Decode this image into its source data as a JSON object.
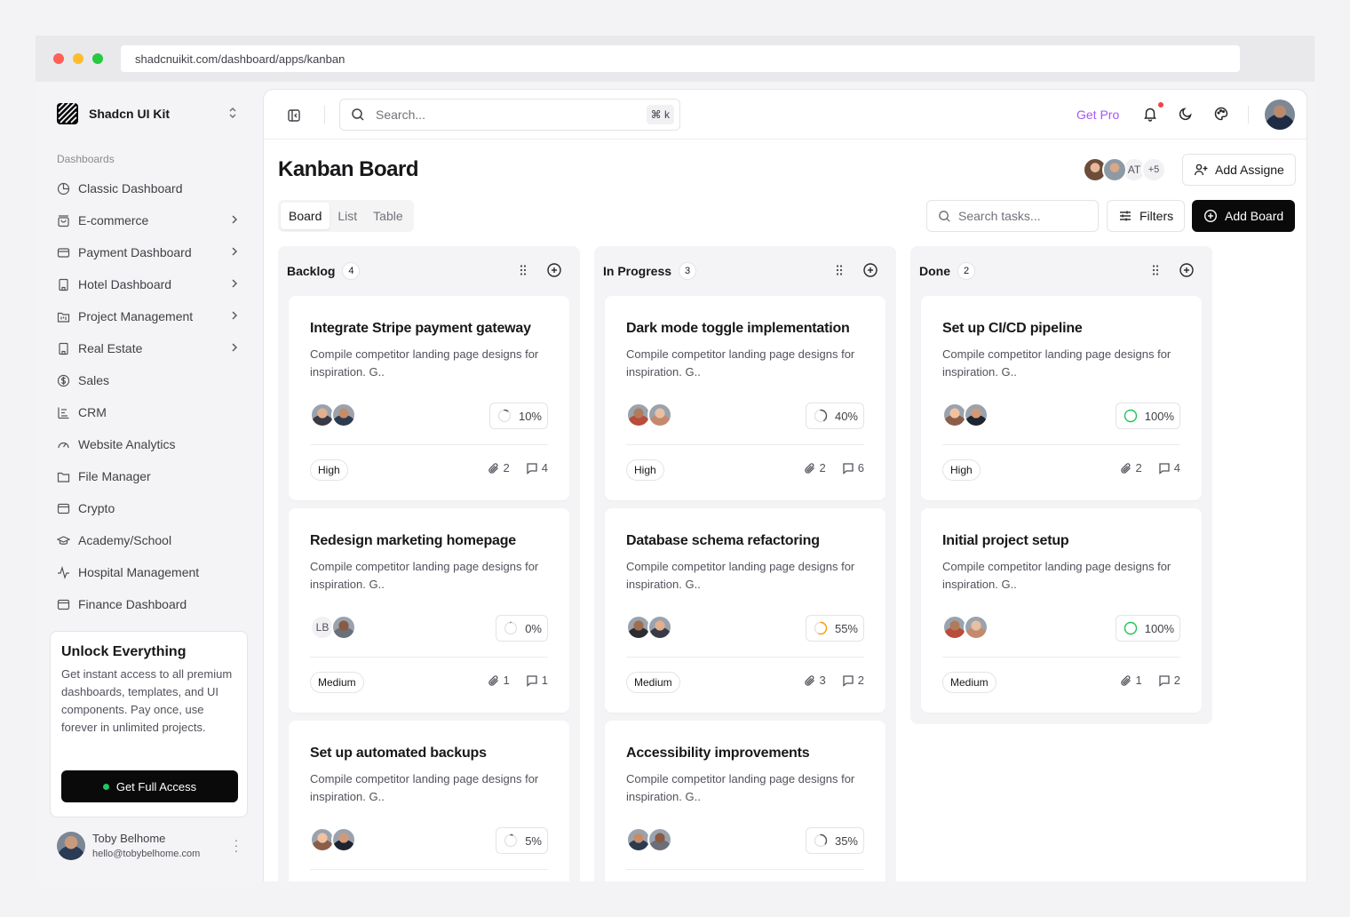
{
  "browser": {
    "url": "shadcnuikit.com/dashboard/apps/kanban"
  },
  "sidebar": {
    "brand": "Shadcn UI Kit",
    "section_label": "Dashboards",
    "items": [
      {
        "label": "Classic Dashboard",
        "icon": "pie-chart-icon",
        "chevron": false
      },
      {
        "label": "E-commerce",
        "icon": "shopping-bag-icon",
        "chevron": true
      },
      {
        "label": "Payment Dashboard",
        "icon": "credit-card-icon",
        "chevron": true
      },
      {
        "label": "Hotel Dashboard",
        "icon": "building-icon",
        "chevron": true
      },
      {
        "label": "Project Management",
        "icon": "folder-kanban-icon",
        "chevron": true
      },
      {
        "label": "Real Estate",
        "icon": "building-icon",
        "chevron": true
      },
      {
        "label": "Sales",
        "icon": "badge-dollar-icon",
        "chevron": false
      },
      {
        "label": "CRM",
        "icon": "chart-bars-icon",
        "chevron": false
      },
      {
        "label": "Website Analytics",
        "icon": "gauge-icon",
        "chevron": false
      },
      {
        "label": "File Manager",
        "icon": "folder-icon",
        "chevron": false
      },
      {
        "label": "Crypto",
        "icon": "wallet-icon",
        "chevron": false
      },
      {
        "label": "Academy/School",
        "icon": "graduation-cap-icon",
        "chevron": false
      },
      {
        "label": "Hospital Management",
        "icon": "activity-icon",
        "chevron": false
      },
      {
        "label": "Finance Dashboard",
        "icon": "wallet-icon",
        "chevron": false
      }
    ],
    "promo": {
      "title": "Unlock Everything",
      "text": "Get instant access to all premium dashboards, templates, and UI components. Pay once, use forever in unlimited projects.",
      "button": "Get Full Access"
    },
    "user": {
      "name": "Toby Belhome",
      "email": "hello@tobybelhome.com"
    }
  },
  "topbar": {
    "search_placeholder": "Search...",
    "shortcut": "⌘ k",
    "get_pro": "Get Pro"
  },
  "page": {
    "title": "Kanban Board",
    "assignees_initials": "AT",
    "assignees_more": "+5",
    "add_assignee": "Add Assigne",
    "tabs": [
      "Board",
      "List",
      "Table"
    ],
    "active_tab": "Board",
    "task_search_placeholder": "Search tasks...",
    "filters": "Filters",
    "add_board": "Add Board"
  },
  "colors": {
    "accent": "#0a0a0a",
    "get_pro": "#a855f7",
    "done": "#22c55e",
    "progress": "#f59e0b"
  },
  "columns": [
    {
      "name": "Backlog",
      "count": "4",
      "cards": [
        {
          "title": "Integrate Stripe payment gateway",
          "desc": "Compile competitor landing page designs for inspiration. G..",
          "progress": 10,
          "progress_label": "10%",
          "priority": "High",
          "attachments": "2",
          "comments": "4",
          "initials": ""
        },
        {
          "title": "Redesign marketing homepage",
          "desc": "Compile competitor landing page designs for inspiration. G..",
          "progress": 0,
          "progress_label": "0%",
          "priority": "Medium",
          "attachments": "1",
          "comments": "1",
          "initials": "LB"
        },
        {
          "title": "Set up automated backups",
          "desc": "Compile competitor landing page designs for inspiration. G..",
          "progress": 5,
          "progress_label": "5%",
          "priority": "",
          "attachments": "",
          "comments": "",
          "initials": ""
        }
      ]
    },
    {
      "name": "In Progress",
      "count": "3",
      "cards": [
        {
          "title": "Dark mode toggle implementation",
          "desc": "Compile competitor landing page designs for inspiration. G..",
          "progress": 40,
          "progress_label": "40%",
          "priority": "High",
          "attachments": "2",
          "comments": "6",
          "initials": ""
        },
        {
          "title": "Database schema refactoring",
          "desc": "Compile competitor landing page designs for inspiration. G..",
          "progress": 55,
          "progress_label": "55%",
          "priority": "Medium",
          "attachments": "3",
          "comments": "2",
          "initials": ""
        },
        {
          "title": "Accessibility improvements",
          "desc": "Compile competitor landing page designs for inspiration. G..",
          "progress": 35,
          "progress_label": "35%",
          "priority": "",
          "attachments": "",
          "comments": "",
          "initials": ""
        }
      ]
    },
    {
      "name": "Done",
      "count": "2",
      "cards": [
        {
          "title": "Set up CI/CD pipeline",
          "desc": "Compile competitor landing page designs for inspiration. G..",
          "progress": 100,
          "progress_label": "100%",
          "priority": "High",
          "attachments": "2",
          "comments": "4",
          "initials": ""
        },
        {
          "title": "Initial project setup",
          "desc": "Compile competitor landing page designs for inspiration. G..",
          "progress": 100,
          "progress_label": "100%",
          "priority": "Medium",
          "attachments": "1",
          "comments": "2",
          "initials": ""
        }
      ]
    }
  ]
}
